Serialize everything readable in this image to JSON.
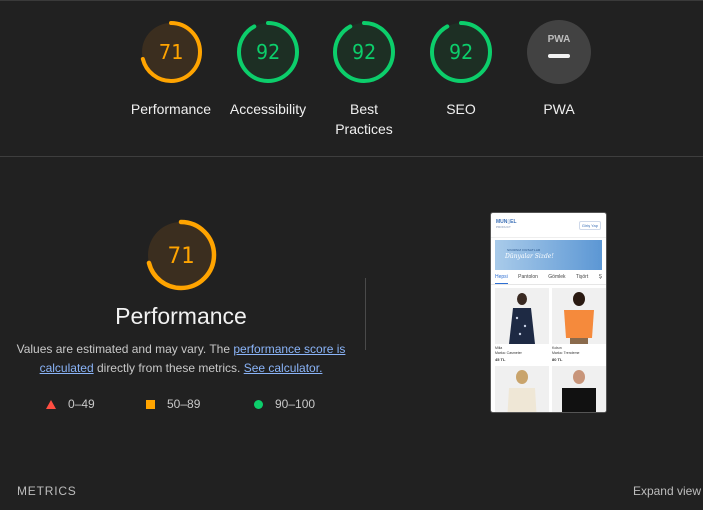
{
  "summary_gauges": [
    {
      "score": "71",
      "label": "Performance",
      "fraction": 0.71,
      "color": "#ffa400",
      "bg": "#3b2e1f"
    },
    {
      "score": "92",
      "label": "Accessibility",
      "fraction": 0.92,
      "color": "#0cce6b",
      "bg": "#1d2f24"
    },
    {
      "score": "92",
      "label": "Best Practices",
      "fraction": 0.92,
      "color": "#0cce6b",
      "bg": "#1d2f24"
    },
    {
      "score": "92",
      "label": "SEO",
      "fraction": 0.92,
      "color": "#0cce6b",
      "bg": "#1d2f24"
    }
  ],
  "pwa": {
    "badge": "PWA",
    "label": "PWA",
    "bg": "#424242"
  },
  "performance": {
    "score": "71",
    "fraction": 0.71,
    "title": "Performance",
    "desc_pre": "Values are estimated and may vary. The ",
    "link_score": "performance score is calculated",
    "desc_mid": " directly from these metrics. ",
    "link_calc": "See calculator."
  },
  "legend": [
    {
      "shape": "triangle",
      "range": "0–49",
      "color": "#ff4e42"
    },
    {
      "shape": "square",
      "range": "50–89",
      "color": "#ffa400"
    },
    {
      "shape": "circle",
      "range": "90–100",
      "color": "#0cce6b"
    }
  ],
  "screenshot": {
    "logo": "MUN▯EL",
    "logo_sub": "PRODUCT",
    "button": "Giriş Yap",
    "banner_small": "SINIRSIZ FIRSATLAR",
    "banner_big": "Dünyalar Sizde!",
    "tabs": [
      "Hepsi",
      "Pantolon",
      "Gömlek",
      "Tişört",
      "Ş"
    ],
    "products": [
      {
        "name": "Milia",
        "brand": "Marka: Casmeter",
        "price": "45 TL",
        "color": "#1e2a44"
      },
      {
        "name": "Kolsın",
        "brand": "Marka: Trendeme",
        "price": "80 TL",
        "color": "#f58a3c"
      },
      {
        "name": "",
        "brand": "",
        "price": "",
        "color": "#efe7d6"
      },
      {
        "name": "",
        "brand": "",
        "price": "",
        "color": "#111111"
      }
    ]
  },
  "footer": {
    "metrics": "METRICS",
    "expand": "Expand view"
  }
}
